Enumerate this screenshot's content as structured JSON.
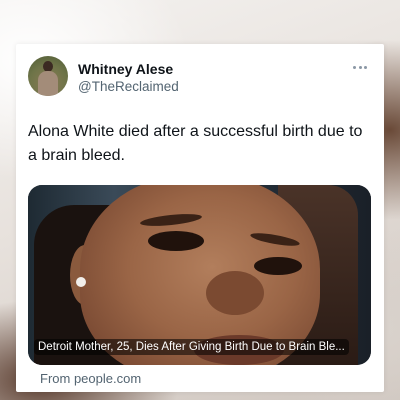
{
  "author": {
    "name": "Whitney Alese",
    "handle": "@TheReclaimed"
  },
  "tweet": {
    "text": "Alona White died after a successful birth due to a brain bleed."
  },
  "link_card": {
    "title": "Detroit Mother, 25, Dies After Giving Birth Due to Brain Ble...",
    "source": "From people.com"
  },
  "icons": {
    "more": "more-options-icon"
  }
}
